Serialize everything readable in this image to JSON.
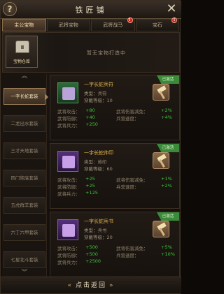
{
  "header": {
    "title": "铁匠铺",
    "help": "?",
    "close": "✕"
  },
  "tabs": [
    {
      "label": "主公宝物",
      "active": true,
      "alert": false
    },
    {
      "label": "武将宝物",
      "active": false,
      "alert": false
    },
    {
      "label": "武将战马",
      "active": false,
      "alert": true
    },
    {
      "label": "宝石",
      "active": false,
      "alert": true
    }
  ],
  "banner": {
    "chest_label": "宝物仓库",
    "message": "暂无宝物打造中"
  },
  "sidebar": {
    "items": [
      {
        "label": "一字长蛇套装",
        "active": true
      },
      {
        "label": "二龙出水套装",
        "active": false
      },
      {
        "label": "三才天地套装",
        "active": false
      },
      {
        "label": "四门兜底套装",
        "active": false
      },
      {
        "label": "五虎群羊套装",
        "active": false
      },
      {
        "label": "六丁六甲套装",
        "active": false
      },
      {
        "label": "七星北斗套装",
        "active": false
      }
    ],
    "up": "︽",
    "down": "︾"
  },
  "cards": [
    {
      "name": "一字长蛇兵符",
      "type": "类型：兵符",
      "req": "穿戴等级：10",
      "ribbon": "已激活",
      "color": "green",
      "stats": [
        {
          "label": "武将攻击：",
          "value": "+80",
          "label2": "武将伤害减免：",
          "value2": "+2%"
        },
        {
          "label": "武将防御：",
          "value": "+40",
          "label2": "兵营速度：",
          "value2": "+4%"
        },
        {
          "label": "武将兵力：",
          "value": "+250",
          "label2": "",
          "value2": ""
        }
      ]
    },
    {
      "name": "一字长蛇帅印",
      "type": "类型：帅印",
      "req": "穿戴等级：60",
      "ribbon": "已激活",
      "color": "purple",
      "stats": [
        {
          "label": "武将攻击：",
          "value": "+25",
          "label2": "武将伤害减免：",
          "value2": "+1%"
        },
        {
          "label": "武将防御：",
          "value": "+25",
          "label2": "兵营速度：",
          "value2": "+2%"
        },
        {
          "label": "武将兵力：",
          "value": "+125",
          "label2": "",
          "value2": ""
        }
      ]
    },
    {
      "name": "一字长蛇兵书",
      "type": "类型：兵书",
      "req": "穿戴等级：20",
      "ribbon": "已激活",
      "color": "purple",
      "stats": [
        {
          "label": "武将攻击：",
          "value": "+500",
          "label2": "武将伤害减免：",
          "value2": "+5%"
        },
        {
          "label": "武将防御：",
          "value": "+500",
          "label2": "兵营速度：",
          "value2": "+10%"
        },
        {
          "label": "武将兵力：",
          "value": "+2500",
          "label2": "",
          "value2": ""
        }
      ]
    }
  ],
  "footer": {
    "back_label": "点击返回"
  }
}
